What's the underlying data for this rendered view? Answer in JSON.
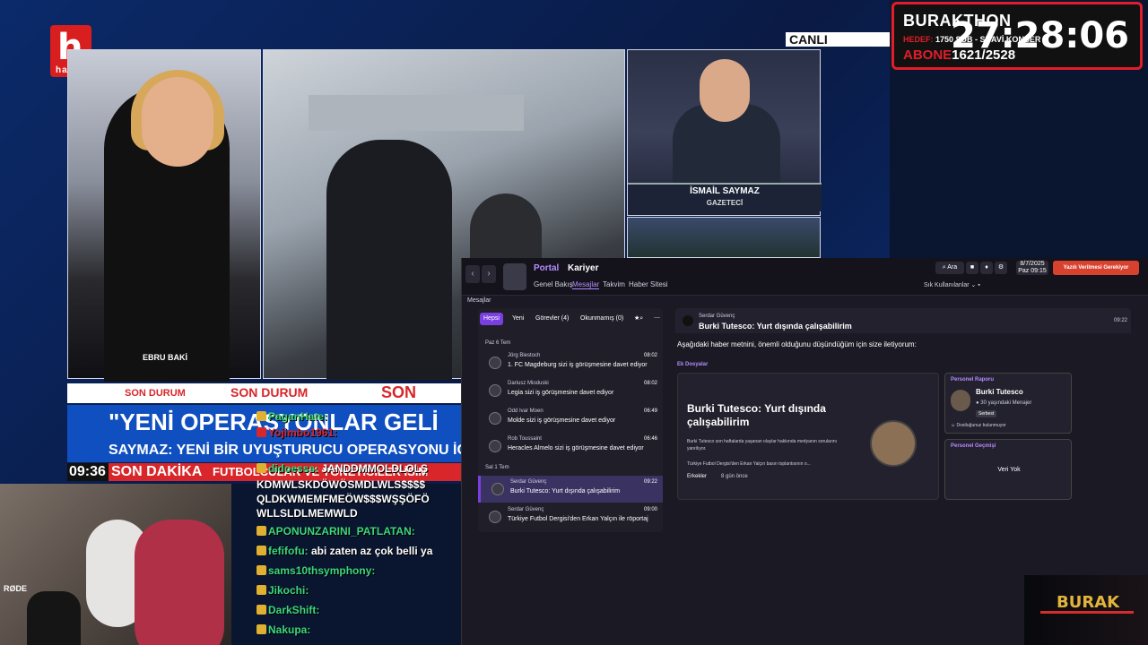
{
  "tv": {
    "channel_logo_mark": "h",
    "channel_logo_text": "halk",
    "live_label": "CANLI",
    "host_name": "EBRU BAKİ",
    "guest_name": "İSMAİL SAYMAZ",
    "guest_title": "GAZETECİ",
    "ticker_top": "SON DURUM",
    "headline": "\"YENİ OPERASYONLAR GELİ",
    "subheadline": "SAYMAZ: YENİ BİR UYUŞTURUCU OPERASYONU İÇİN Cİ",
    "clock": "09:36",
    "breaking_label": "SON DAKİKA",
    "breaking_text": "FUTBOLCULAR VE YÖNETİCİLER İSİM"
  },
  "subathon": {
    "title": "BURAKTHON",
    "goal_key": "HEDEF:",
    "goal_value": "1750 SUB - SUAVİ KONSER",
    "subs_key": "ABONE",
    "subs_value": "1621/2528",
    "timer": "27:28:06"
  },
  "webcam": {
    "mic_brand": "RØDE"
  },
  "chat": [
    {
      "user": "PaganHate:",
      "text": "",
      "color": "#3dd77a"
    },
    {
      "user": "Yojimbo1961:",
      "text": "",
      "color": "#d8262a"
    },
    {
      "user": "didoesss:",
      "text": "JANDDMMOLDLOLŞ",
      "color": "#3dd77a"
    },
    {
      "user": "",
      "text": "KDMWLSKDÖWÖSMDLWLS$$$$",
      "color": "#ffffff"
    },
    {
      "user": "",
      "text": "QLDKWMEMFMEÖW$$$WŞŞÖFÖ",
      "color": "#ffffff"
    },
    {
      "user": "",
      "text": "WLLSLDLMEMWLD",
      "color": "#ffffff"
    },
    {
      "user": "APONUNZARINI_PATLATAN:",
      "text": "",
      "color": "#3dd77a"
    },
    {
      "user": "fefifofu:",
      "text": "abi zaten az çok belli ya",
      "color": "#3dd77a"
    },
    {
      "user": "sams10thsymphony:",
      "text": "",
      "color": "#3dd77a"
    },
    {
      "user": "Jikochi:",
      "text": "",
      "color": "#3dd77a"
    },
    {
      "user": "DarkShift:",
      "text": "",
      "color": "#3dd77a"
    },
    {
      "user": "Nakupa:",
      "text": "",
      "color": "#3dd77a"
    }
  ],
  "fm": {
    "portal": "Portal",
    "kariyer": "Kariyer",
    "subnav": [
      "Genel Bakış",
      "Mesajlar",
      "Takvim",
      "Haber Sitesi"
    ],
    "search": "Ara",
    "date_line1": "8/7/2025",
    "date_line2": "Paz 09:15",
    "alert": "Yazılı Verilmesi Gerekiyor",
    "frequent": "Sık Kullanılanlar",
    "section": "Mesajlar",
    "tabs": [
      "Hepsi",
      "Yeni",
      "Görevler (4)",
      "Okunmamış (0)"
    ],
    "group1": "Paz 6 Tem",
    "group2": "Sal 1 Tem",
    "messages": [
      {
        "sender": "Jörg Biestoch",
        "subject": "1. FC Magdeburg sizi iş görüşmesine davet ediyor",
        "time": "08:02"
      },
      {
        "sender": "Dariusz Mioduski",
        "subject": "Legia sizi iş görüşmesine davet ediyor",
        "time": "08:02"
      },
      {
        "sender": "Odd Ivar Moen",
        "subject": "Molde sizi iş görüşmesine davet ediyor",
        "time": "06:49"
      },
      {
        "sender": "Rob Toussaint",
        "subject": "Heracles Almelo sizi iş görüşmesine davet ediyor",
        "time": "06:46"
      },
      {
        "sender": "Serdar Güvenç",
        "subject": "Burki Tutesco: Yurt dışında çalışabilirim",
        "time": "09:22"
      },
      {
        "sender": "Serdar Güvenç",
        "subject": "Türkiye Futbol Dergisi'den Erkan Yalçın ile röportaj",
        "time": "09:00"
      }
    ],
    "detail": {
      "from": "Serdar Güvenç",
      "subject": "Burki Tutesco: Yurt dışında çalışabilirim",
      "time": "09:22",
      "body": "Aşağıdaki haber metnini, önemli olduğunu düşündüğüm için size iletiyorum:",
      "attachments_label": "Ek Dosyalar",
      "card_title": "Burki Tutesco: Yurt dışında çalışabilirim",
      "card_text": "Burki Tutesco son haftalarda yaşanan olaylar hakkında medyanın sorularını yanıtlıyor.",
      "card_text2": "Türkiye Futbol Dergisi'den Erkan Yalçın basın toplantısının o...",
      "card_cat": "Erkekler",
      "card_ago": "8 gün önce",
      "report_label": "Personel Raporu",
      "person_name": "Burki Tutesco",
      "person_desc": "30 yaşındaki Menajer",
      "person_status": "Serbest",
      "person_note": "Dostluğunuz bulunmuyor",
      "history_label": "Personel Geçmişi",
      "history_empty": "Veri Yok"
    }
  },
  "overlay_logo": "BURAK"
}
